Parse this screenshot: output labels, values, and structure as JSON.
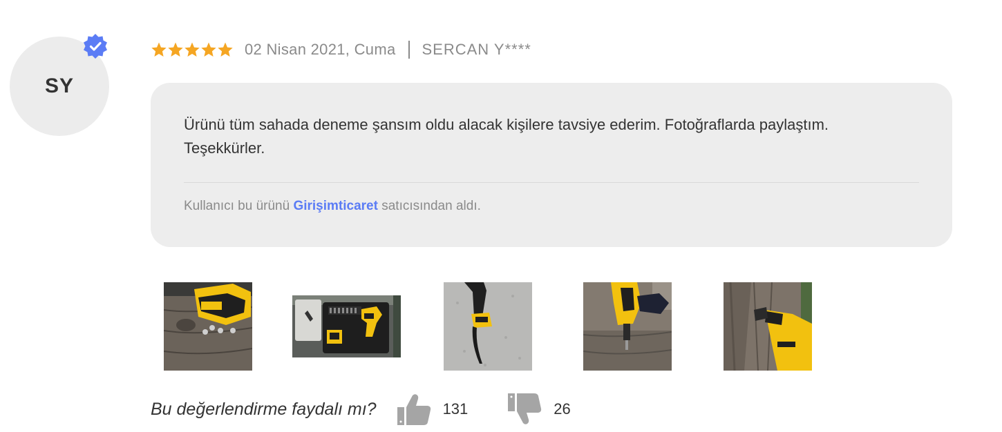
{
  "reviewer": {
    "initials": "SY",
    "name": "SERCAN Y****",
    "verified": true
  },
  "rating": {
    "stars": 5,
    "max": 5,
    "color": "#f5a623"
  },
  "date": "02 Nisan 2021, Cuma",
  "comment": {
    "line1": "Ürünü tüm sahada deneme şansım oldu alacak kişilere tavsiye ederim. Fotoğraflarda paylaştım.",
    "line2": "Teşekkürler."
  },
  "seller": {
    "prefix": "Kullanıcı bu ürünü",
    "name": "Girişimticaret",
    "suffix": "satıcısından aldı."
  },
  "photos": [
    {
      "name": "review-photo-1"
    },
    {
      "name": "review-photo-2"
    },
    {
      "name": "review-photo-3"
    },
    {
      "name": "review-photo-4"
    },
    {
      "name": "review-photo-5"
    }
  ],
  "helpful": {
    "question": "Bu değerlendirme faydalı mı?",
    "up_count": "131",
    "down_count": "26",
    "up_icon": "thumbs-up-icon",
    "down_icon": "thumbs-down-icon"
  },
  "colors": {
    "accent": "#5b7cf5",
    "star": "#f5a623",
    "bubble": "#ededed",
    "muted_text": "#8a8a8a"
  }
}
